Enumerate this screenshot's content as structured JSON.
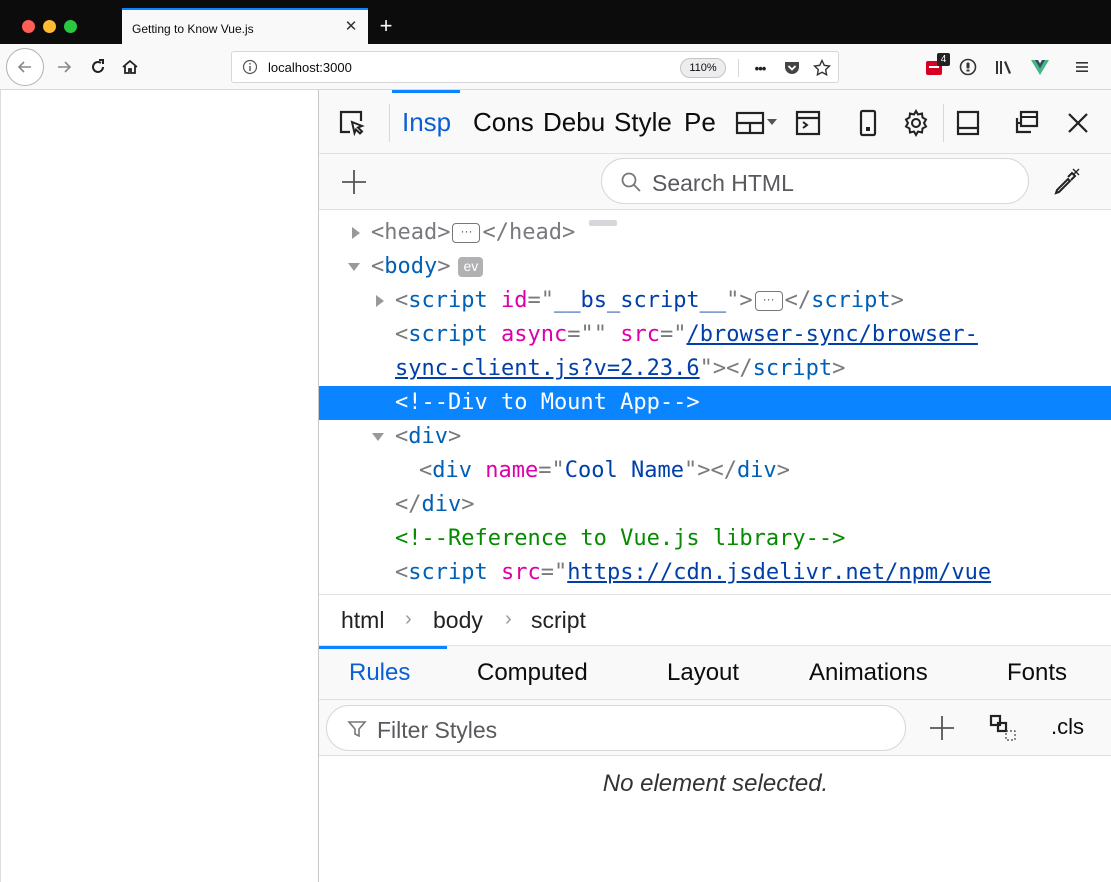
{
  "browser": {
    "tab_title": "Getting to Know Vue.js",
    "tab_close": "✕",
    "new_tab": "+",
    "url": "localhost:3000",
    "zoom": "110%",
    "page_actions": "•••",
    "extension_badge": "4"
  },
  "devtools": {
    "tabs": [
      {
        "label": "Insp",
        "active": true
      },
      {
        "label": "Cons",
        "active": false
      },
      {
        "label": "Debu",
        "active": false
      },
      {
        "label": "Style",
        "active": false
      },
      {
        "label": "Pe",
        "active": false
      }
    ],
    "search_placeholder": "Search HTML",
    "markup": {
      "l1_open": "<head>",
      "l1_close": "</head>",
      "l2_tag": "body",
      "l2_badge": "ev",
      "l3_id": "__bs_script__",
      "l4_src_a": "/browser-sync/browser-",
      "l4_src_b": "sync-client.js?v=2.23.6",
      "l5_comment": "<!--Div to Mount App-->",
      "l7_name_val": "Cool Name",
      "l9_comment": "<!--Reference to Vue.js library-->",
      "l10_src": "https://cdn.jsdelivr.net/npm/vue"
    },
    "breadcrumbs": [
      "html",
      "body",
      "script"
    ],
    "rule_tabs": [
      {
        "label": "Rules",
        "active": true
      },
      {
        "label": "Computed",
        "active": false
      },
      {
        "label": "Layout",
        "active": false
      },
      {
        "label": "Animations",
        "active": false
      },
      {
        "label": "Fonts",
        "active": false
      }
    ],
    "filter_placeholder": "Filter Styles",
    "cls_label": ".cls",
    "empty_message": "No element selected."
  },
  "colors": {
    "accent": "#0a84ff",
    "selection": "#0a84ff",
    "tagname": "#0060b6",
    "attribute": "#dd00a9",
    "value": "#003eaa",
    "comment": "#058b00",
    "vue_logo": "#41b883",
    "extension_red": "#d70022"
  },
  "icons": [
    "back-icon",
    "forward-icon",
    "reload-icon",
    "home-icon",
    "info-icon",
    "pocket-icon",
    "star-icon",
    "extension-icon",
    "password-icon",
    "library-icon",
    "vue-devtools-icon",
    "menu-icon",
    "element-picker-icon",
    "split-layout-icon",
    "console-split-icon",
    "responsive-icon",
    "gear-icon",
    "dock-bottom-icon",
    "separate-window-icon",
    "close-icon",
    "add-node-icon",
    "eyedropper-icon",
    "search-icon",
    "filter-icon",
    "add-rule-icon",
    "pseudo-class-icon"
  ]
}
